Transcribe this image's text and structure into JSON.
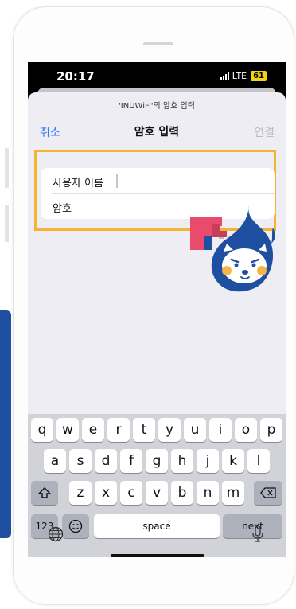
{
  "status_bar": {
    "time": "20:17",
    "network": "LTE",
    "battery": "61"
  },
  "sheet": {
    "subtitle": "'INUWiFi'의 암호 입력",
    "cancel_label": "취소",
    "title": "암호 입력",
    "connect_label": "연결",
    "username_label": "사용자 이름",
    "password_label": "암호"
  },
  "keyboard": {
    "row1": [
      "q",
      "w",
      "e",
      "r",
      "t",
      "y",
      "u",
      "i",
      "o",
      "p"
    ],
    "row2": [
      "a",
      "s",
      "d",
      "f",
      "g",
      "h",
      "j",
      "k",
      "l"
    ],
    "row3": [
      "z",
      "x",
      "c",
      "v",
      "b",
      "n",
      "m"
    ],
    "numbers_label": "123",
    "space_label": "space",
    "next_label": "next"
  },
  "colors": {
    "accent": "#2b7cf6",
    "highlight": "#f4b431",
    "brand_blue": "#1e4fa0"
  }
}
